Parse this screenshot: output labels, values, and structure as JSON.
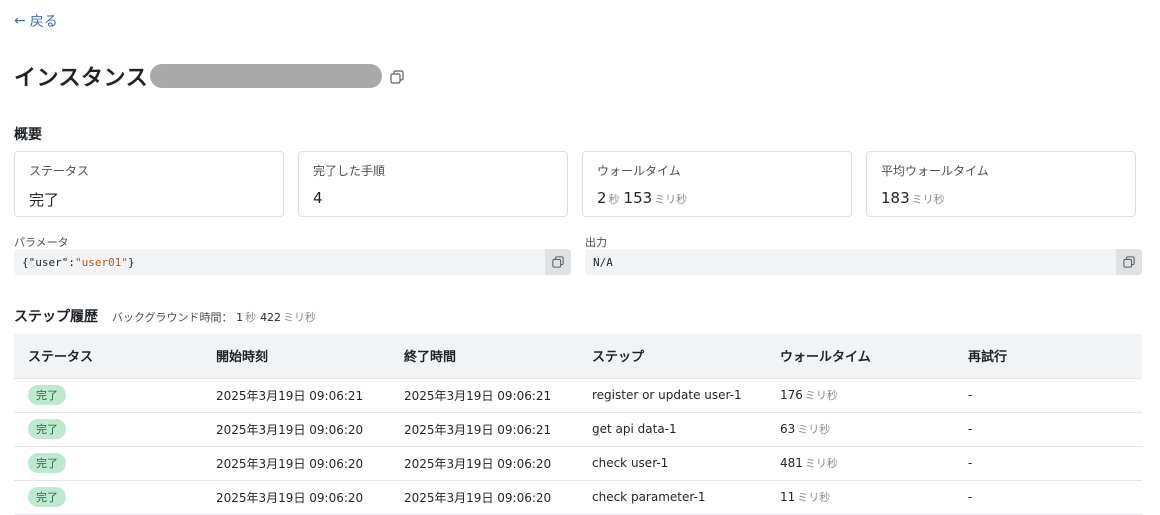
{
  "nav": {
    "back_arrow": "←",
    "back_label": "戻る"
  },
  "header": {
    "title": "インスタンス",
    "copy_icon": "copy-icon"
  },
  "overview": {
    "section_label": "概要",
    "cards": [
      {
        "label": "ステータス",
        "value": "完了"
      },
      {
        "label": "完了した手順",
        "value": "4"
      },
      {
        "label": "ウォールタイム",
        "value_sec": "2",
        "unit_sec": "秒",
        "value_ms": "153",
        "unit_ms": "ミリ秒"
      },
      {
        "label": "平均ウォールタイム",
        "value_ms": "183",
        "unit_ms": "ミリ秒"
      }
    ]
  },
  "parameters": {
    "label": "パラメータ",
    "key": "{\"user\":",
    "string": "\"user01\"",
    "close": "}"
  },
  "output": {
    "label": "出力",
    "value": "N/A"
  },
  "steps": {
    "title": "ステップ履歴",
    "bg_label": "バックグラウンド時間：",
    "bg_sec": "1",
    "bg_sec_unit": "秒",
    "bg_ms": "422",
    "bg_ms_unit": "ミリ秒",
    "columns": [
      "ステータス",
      "開始時刻",
      "終了時間",
      "ステップ",
      "ウォールタイム",
      "再試行"
    ],
    "rows": [
      {
        "status": "完了",
        "start": "2025年3月19日 09:06:21",
        "end": "2025年3月19日 09:06:21",
        "step": "register or update user-1",
        "wall": "176",
        "wall_unit": "ミリ秒",
        "retry": "-"
      },
      {
        "status": "完了",
        "start": "2025年3月19日 09:06:20",
        "end": "2025年3月19日 09:06:21",
        "step": "get api data-1",
        "wall": "63",
        "wall_unit": "ミリ秒",
        "retry": "-"
      },
      {
        "status": "完了",
        "start": "2025年3月19日 09:06:20",
        "end": "2025年3月19日 09:06:20",
        "step": "check user-1",
        "wall": "481",
        "wall_unit": "ミリ秒",
        "retry": "-"
      },
      {
        "status": "完了",
        "start": "2025年3月19日 09:06:20",
        "end": "2025年3月19日 09:06:20",
        "step": "check parameter-1",
        "wall": "11",
        "wall_unit": "ミリ秒",
        "retry": "-"
      }
    ]
  },
  "colors": {
    "accent": "#3b6fc4",
    "badge_bg": "#bfe9cf",
    "badge_text": "#1c6b3a",
    "json_string": "#b4541f"
  }
}
